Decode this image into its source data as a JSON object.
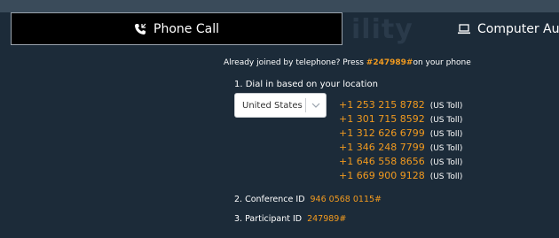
{
  "tabs": {
    "phone_label": "Phone Call",
    "computer_label": "Computer Audio",
    "phone_icon": "phone-icon",
    "computer_icon": "laptop-icon"
  },
  "background_text": "ility",
  "joined": {
    "prefix": "Already joined by telephone? Press ",
    "code": "#247989#",
    "suffix": "on your phone"
  },
  "step1": {
    "label": "1. Dial in based on your location",
    "country_selected": "United States ...",
    "numbers": [
      {
        "number": "+1 253 215 8782",
        "type": "(US Toll)"
      },
      {
        "number": "+1 301 715 8592",
        "type": "(US Toll)"
      },
      {
        "number": "+1 312 626 6799",
        "type": "(US Toll)"
      },
      {
        "number": "+1 346 248 7799",
        "type": "(US Toll)"
      },
      {
        "number": "+1 646 558 8656",
        "type": "(US Toll)"
      },
      {
        "number": "+1 669 900 9128",
        "type": "(US Toll)"
      }
    ]
  },
  "step2": {
    "label": "2. Conference ID",
    "value": "946 0568 0115#"
  },
  "step3": {
    "label": "3. Participant ID",
    "value": "247989#"
  },
  "colors": {
    "background": "#1c2b39",
    "accent": "#f19a1f",
    "tab_active": "#000000"
  }
}
